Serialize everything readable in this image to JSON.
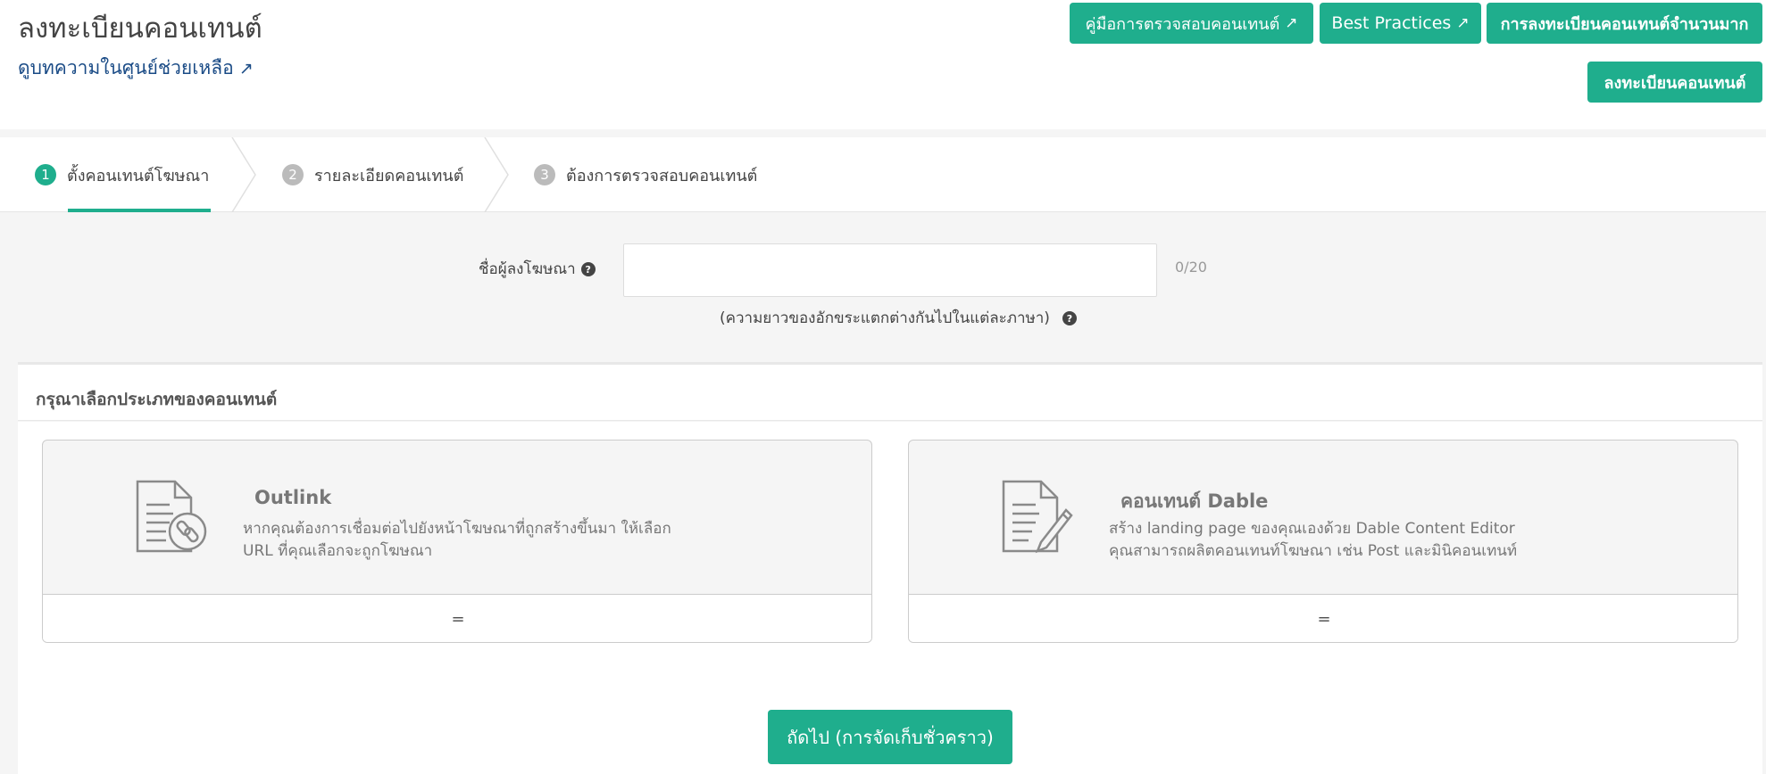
{
  "header": {
    "title": "ลงทะเบียนคอนเทนต์",
    "help_link": "ดูบทความในศูนย์ช่วยเหลือ",
    "buttons": {
      "guide": "คู่มือการตรวจสอบคอนเทนต์",
      "best_practices": "Best Practices",
      "bulk_register": "การลงทะเบียนคอนเทนต์จำนวนมาก",
      "register": "ลงทะเบียนคอนเทนต์"
    }
  },
  "steps": [
    {
      "num": "1",
      "label": "ตั้งคอนเทนต์โฆษณา",
      "active": true
    },
    {
      "num": "2",
      "label": "รายละเอียดคอนเทนต์",
      "active": false
    },
    {
      "num": "3",
      "label": "ต้องการตรวจสอบคอนเทนต์",
      "active": false
    }
  ],
  "form": {
    "advertiser_label": "ชื่อผู้ลงโฆษณา",
    "advertiser_value": "",
    "counter": "0/20",
    "note": "(ความยาวของอักขระแตกต่างกันไปในแต่ละภาษา)"
  },
  "content_type": {
    "title": "กรุณาเลือกประเภทของคอนเทนต์",
    "cards": [
      {
        "icon": "document-link-icon",
        "title": "Outlink",
        "desc_line1": "หากคุณต้องการเชื่อมต่อไปยังหน้าโฆษณาที่ถูกสร้างขึ้นมา ให้เลือก",
        "desc_line2": "URL ที่คุณเลือกจะถูกโฆษณา",
        "footer": "="
      },
      {
        "icon": "document-edit-icon",
        "title": "คอนเทนต์ Dable",
        "desc_line1": "สร้าง landing page ของคุณเองด้วย Dable Content Editor",
        "desc_line2": "คุณสามารถผลิตคอนเทนท์โฆษณา เช่น Post และมินิคอนเทนท์",
        "footer": "="
      }
    ]
  },
  "next_button": "ถัดไป (การจัดเก็บชั่วคราว)",
  "colors": {
    "accent": "#1fae8d",
    "link": "#1a4b86"
  }
}
